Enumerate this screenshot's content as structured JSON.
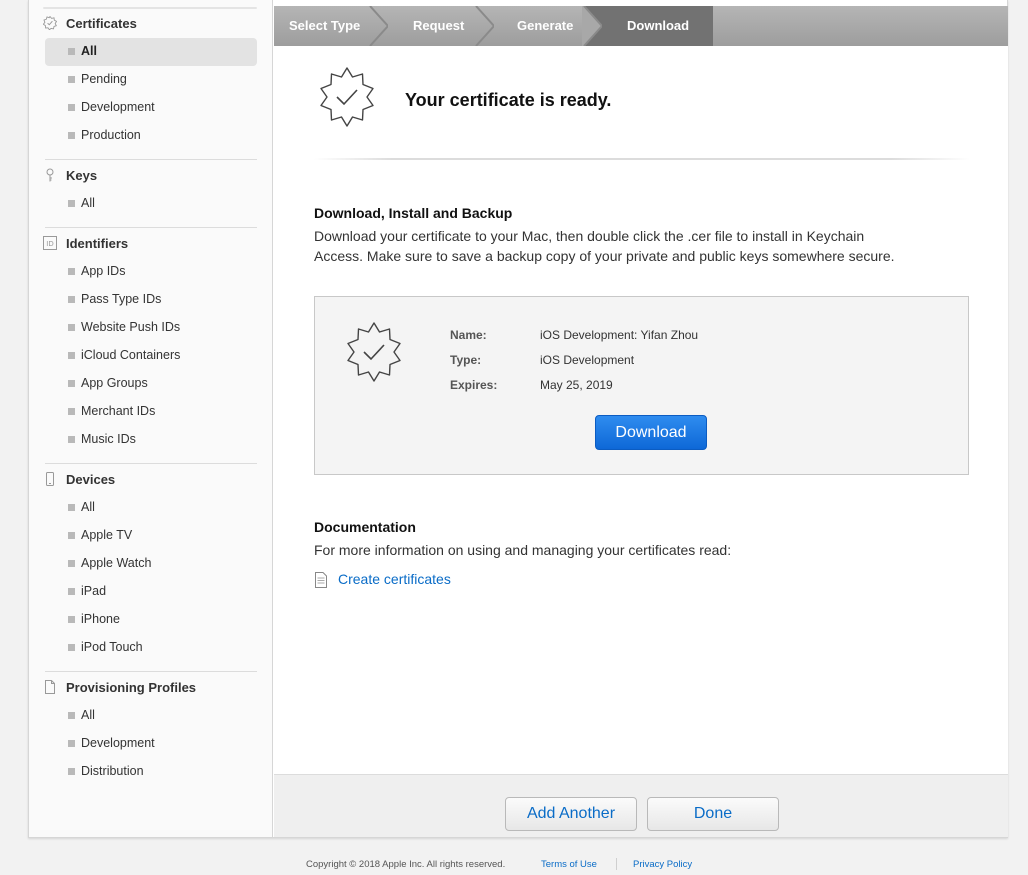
{
  "sidebar": {
    "sections": [
      {
        "title": "Certificates",
        "icon": "certificate-gear-icon",
        "items": [
          "All",
          "Pending",
          "Development",
          "Production"
        ],
        "active": "All"
      },
      {
        "title": "Keys",
        "icon": "key-icon",
        "items": [
          "All"
        ]
      },
      {
        "title": "Identifiers",
        "icon": "id-icon",
        "items": [
          "App IDs",
          "Pass Type IDs",
          "Website Push IDs",
          "iCloud Containers",
          "App Groups",
          "Merchant IDs",
          "Music IDs"
        ]
      },
      {
        "title": "Devices",
        "icon": "device-icon",
        "items": [
          "All",
          "Apple TV",
          "Apple Watch",
          "iPad",
          "iPhone",
          "iPod Touch"
        ]
      },
      {
        "title": "Provisioning Profiles",
        "icon": "document-icon",
        "items": [
          "All",
          "Development",
          "Distribution"
        ]
      }
    ]
  },
  "steps": [
    "Select Type",
    "Request",
    "Generate",
    "Download"
  ],
  "active_step": "Download",
  "ready": {
    "heading": "Your certificate is ready."
  },
  "install": {
    "heading": "Download, Install and Backup",
    "line1": "Download your certificate to your Mac, then double click the .cer file to install in Keychain",
    "line2": "Access. Make sure to save a backup copy of your private and public keys somewhere secure."
  },
  "certificate": {
    "name_label": "Name:",
    "name": "iOS Development: Yifan Zhou",
    "type_label": "Type:",
    "type": "iOS Development",
    "expires_label": "Expires:",
    "expires": "May 25, 2019",
    "download_label": "Download"
  },
  "documentation": {
    "heading": "Documentation",
    "text": "For more information on using and managing your certificates read:",
    "link": "Create certificates"
  },
  "actions": {
    "add_another": "Add Another",
    "done": "Done"
  },
  "footer": {
    "copyright": "Copyright © 2018 Apple Inc. All rights reserved.",
    "terms": "Terms of Use",
    "privacy": "Privacy Policy"
  },
  "colors": {
    "accent": "#0a6cc7",
    "primary_button": "#1a74e0",
    "crumb_active": "#727272"
  }
}
